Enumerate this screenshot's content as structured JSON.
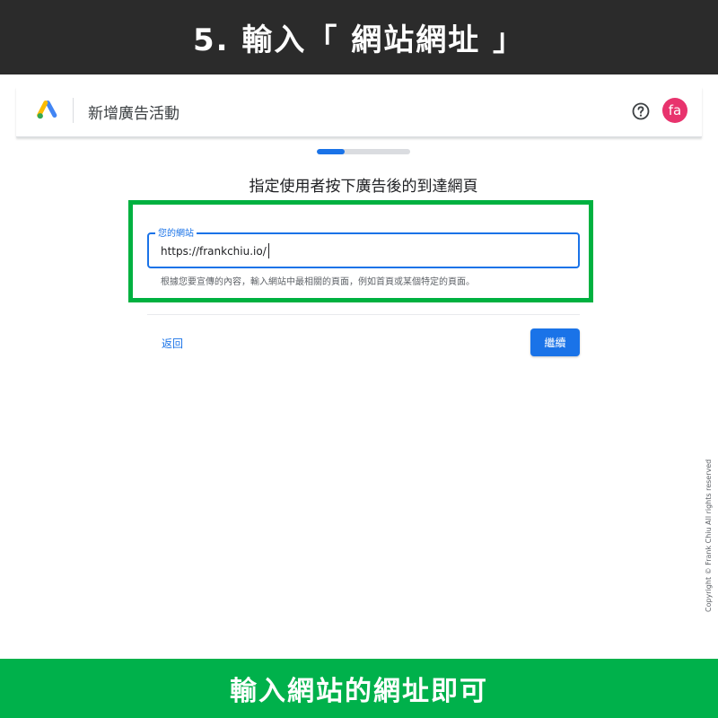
{
  "top_banner": {
    "text": "5. 輸入「 網站網址 」"
  },
  "header": {
    "title": "新增廣告活動",
    "logo_icon": "google-ads-logo-icon",
    "help_icon": "help-circle-icon",
    "avatar_initials": "fa",
    "avatar_color": "#e8336d"
  },
  "progress": {
    "fraction": 0.3
  },
  "step": {
    "heading": "指定使用者按下廣告後的到達網頁"
  },
  "url_field": {
    "label": "您的網站",
    "value": "https://frankchiu.io/",
    "helper": "根據您要宣傳的內容，輸入網站中最相關的頁面，例如首頁或某個特定的頁面。"
  },
  "actions": {
    "back_label": "返回",
    "continue_label": "繼續"
  },
  "watermark": {
    "copyright": "Copyright © Frank Chiu All rights reserved"
  },
  "bottom_banner": {
    "text": "輸入網站的網址即可"
  },
  "colors": {
    "accent": "#1a73e8",
    "highlight": "#00b140",
    "top_banner": "#2b2b2b",
    "bottom_banner": "#00b14b"
  }
}
